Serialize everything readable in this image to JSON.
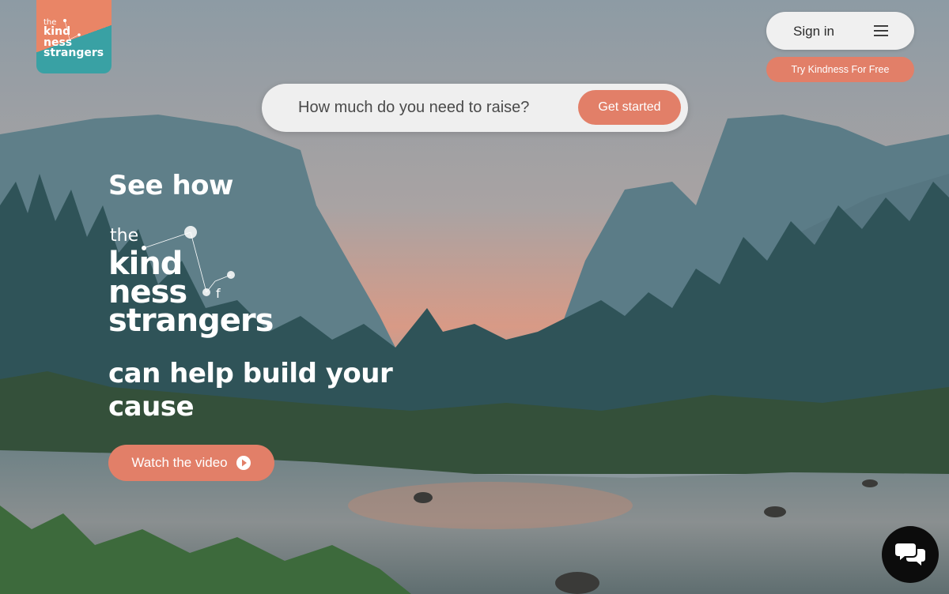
{
  "header": {
    "logo": {
      "line1": "the",
      "line2": "kind",
      "line3": "ness",
      "line4": "strangers"
    },
    "signin_label": "Sign in",
    "menu_icon": "hamburger-menu-icon",
    "try_free_label": "Try Kindness For Free"
  },
  "search": {
    "placeholder": "How much do you need to raise?",
    "button_label": "Get started"
  },
  "hero": {
    "headline_top": "See how",
    "brand": {
      "line1": "the",
      "line2": "kind",
      "line3": "ness",
      "line4": "strangers",
      "of_letter": "f"
    },
    "headline_bottom": "can help build your cause",
    "watch_label": "Watch the video",
    "watch_icon": "play-circle-icon"
  },
  "chat": {
    "icon": "chat-bubbles-icon"
  },
  "colors": {
    "accent": "#e27f68",
    "teal": "#39a1a4",
    "pill_bg": "#efefef",
    "chat_bg": "#0c0c0c"
  }
}
